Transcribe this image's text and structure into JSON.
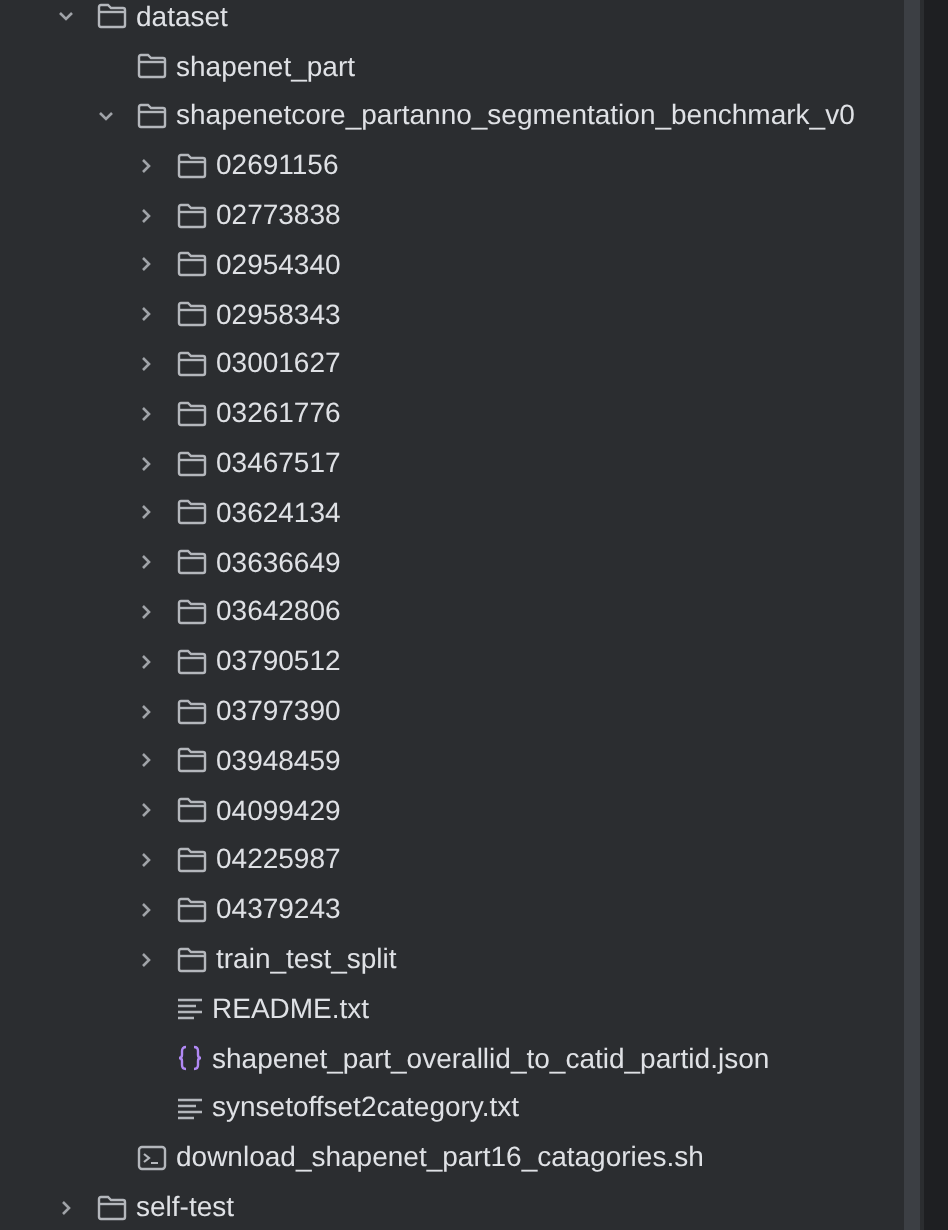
{
  "tree": [
    {
      "label": "dataset",
      "kind": "folder",
      "expanded": true,
      "children": [
        {
          "label": "shapenet_part",
          "kind": "folder"
        },
        {
          "label": "shapenetcore_partanno_segmentation_benchmark_v0",
          "kind": "folder",
          "expanded": true,
          "children": [
            {
              "label": "02691156",
              "kind": "folder",
              "expanded": false
            },
            {
              "label": "02773838",
              "kind": "folder",
              "expanded": false
            },
            {
              "label": "02954340",
              "kind": "folder",
              "expanded": false
            },
            {
              "label": "02958343",
              "kind": "folder",
              "expanded": false
            },
            {
              "label": "03001627",
              "kind": "folder",
              "expanded": false
            },
            {
              "label": "03261776",
              "kind": "folder",
              "expanded": false
            },
            {
              "label": "03467517",
              "kind": "folder",
              "expanded": false
            },
            {
              "label": "03624134",
              "kind": "folder",
              "expanded": false
            },
            {
              "label": "03636649",
              "kind": "folder",
              "expanded": false
            },
            {
              "label": "03642806",
              "kind": "folder",
              "expanded": false
            },
            {
              "label": "03790512",
              "kind": "folder",
              "expanded": false
            },
            {
              "label": "03797390",
              "kind": "folder",
              "expanded": false
            },
            {
              "label": "03948459",
              "kind": "folder",
              "expanded": false
            },
            {
              "label": "04099429",
              "kind": "folder",
              "expanded": false
            },
            {
              "label": "04225987",
              "kind": "folder",
              "expanded": false
            },
            {
              "label": "04379243",
              "kind": "folder",
              "expanded": false
            },
            {
              "label": "train_test_split",
              "kind": "folder",
              "expanded": false
            },
            {
              "label": "README.txt",
              "kind": "text"
            },
            {
              "label": "shapenet_part_overallid_to_catid_partid.json",
              "kind": "json"
            },
            {
              "label": "synsetoffset2category.txt",
              "kind": "text"
            }
          ]
        },
        {
          "label": "download_shapenet_part16_catagories.sh",
          "kind": "shell"
        }
      ]
    },
    {
      "label": "self-test",
      "kind": "folder",
      "expanded": false
    }
  ]
}
